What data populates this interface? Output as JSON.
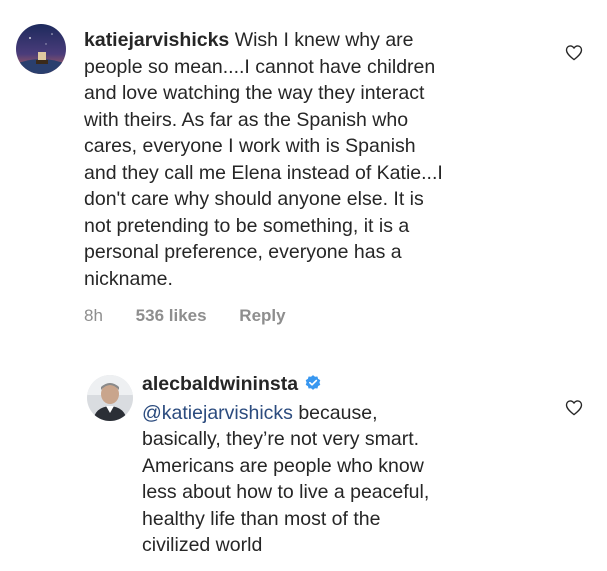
{
  "comments": [
    {
      "username": "katiejarvishicks",
      "text": " Wish I knew why are\npeople so mean....I cannot have children\nand love watching the way they interact\nwith theirs. As far as the Spanish who\ncares, everyone I work with is Spanish\nand they call me Elena instead of Katie...I\ndon't care why should anyone else. It is\nnot pretending to be something, it is a\npersonal preference, everyone has a\nnickname.",
      "time": "8h",
      "likes": "536 likes",
      "reply_label": "Reply",
      "icon": "heart-outline-icon"
    },
    {
      "username": "alecbaldwininsta",
      "verified": true,
      "mention": "@katiejarvishicks",
      "text": " because,\nbasically, they’re not very smart.\nAmericans are people who know\nless about how to live a peaceful,\nhealthy life than most of the\ncivilized world",
      "icon": "heart-outline-icon"
    }
  ],
  "colors": {
    "text": "#262626",
    "meta": "#8e8e8e",
    "mention": "#2b4b7e",
    "verified": "#3897f0"
  }
}
